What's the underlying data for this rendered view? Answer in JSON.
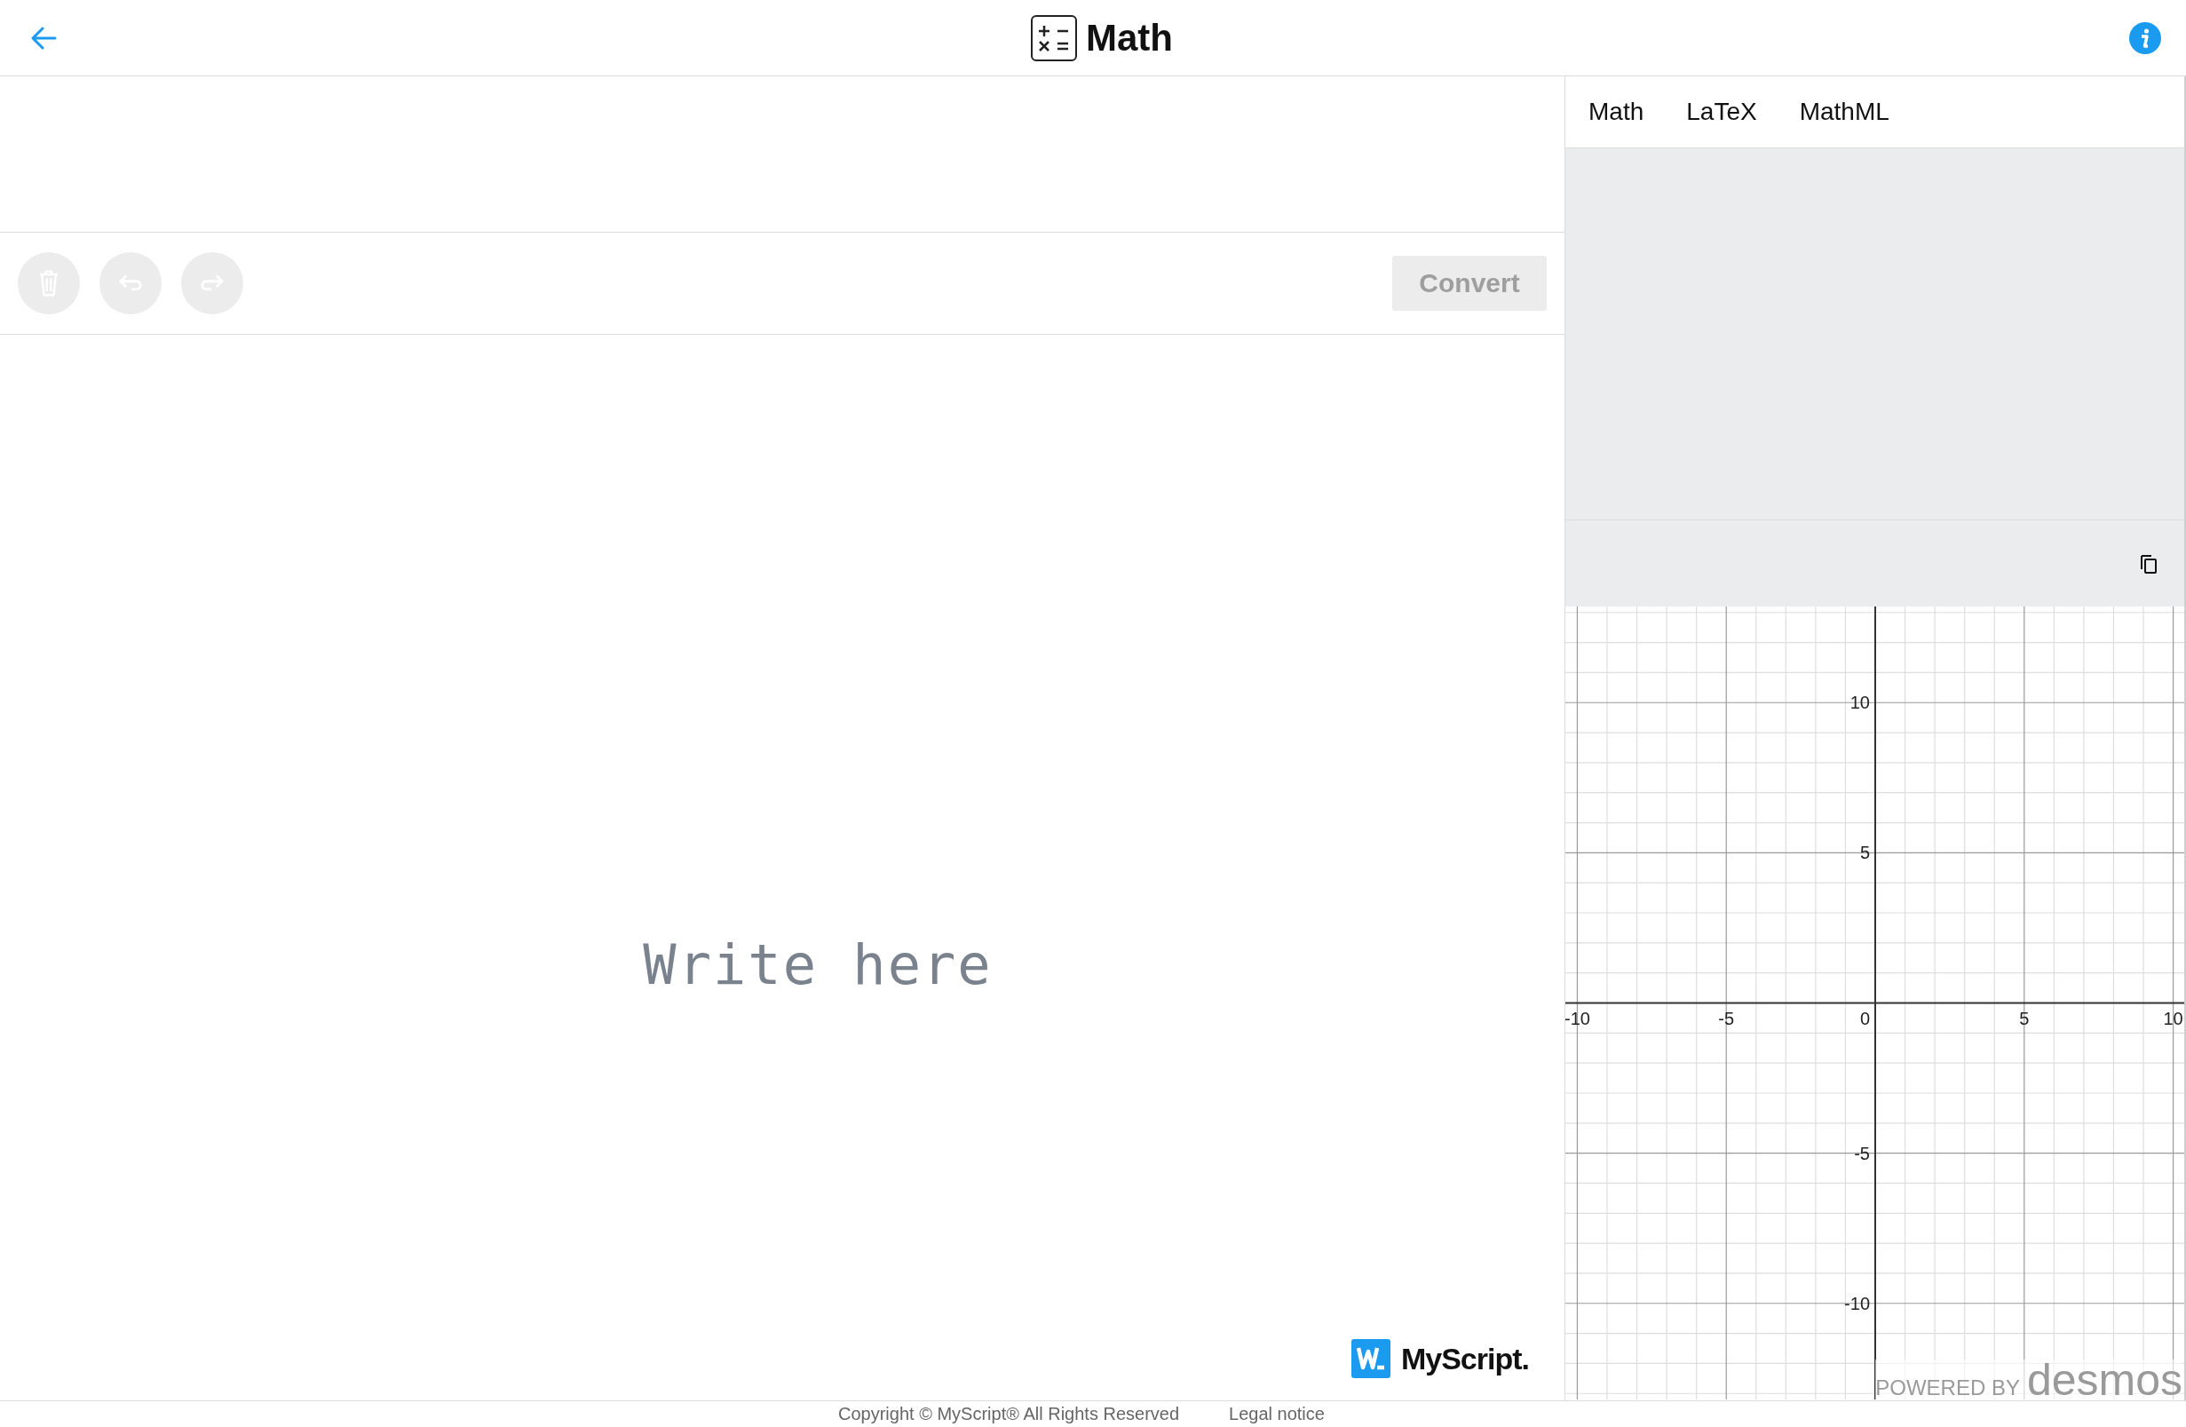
{
  "header": {
    "title": "Math"
  },
  "toolbar": {
    "buttons": [
      {
        "kind": "clear",
        "disabled": true
      },
      {
        "kind": "undo",
        "disabled": true
      },
      {
        "kind": "redo",
        "disabled": true
      }
    ],
    "convert": {
      "label": "Convert",
      "disabled": true
    }
  },
  "canvas": {
    "placeholder": "Write here",
    "brand": "MyScript."
  },
  "output": {
    "tabs": [
      {
        "label": "Math"
      },
      {
        "label": "LaTeX"
      },
      {
        "label": "MathML"
      }
    ]
  },
  "graph": {
    "chart_data": {
      "type": "line",
      "xlim": [
        -10.4,
        10.4
      ],
      "ylim": [
        -13.2,
        13.2
      ],
      "grid": true,
      "xticks": [
        -10,
        -5,
        5,
        10
      ],
      "yticks": [
        -10,
        -5,
        5,
        10
      ]
    },
    "origin_label": "0",
    "powered_by": "POWERED BY",
    "brand": "desmos"
  },
  "footer": {
    "copyright": "Copyright © MyScript® All Rights Reserved",
    "link": "Legal notice"
  }
}
